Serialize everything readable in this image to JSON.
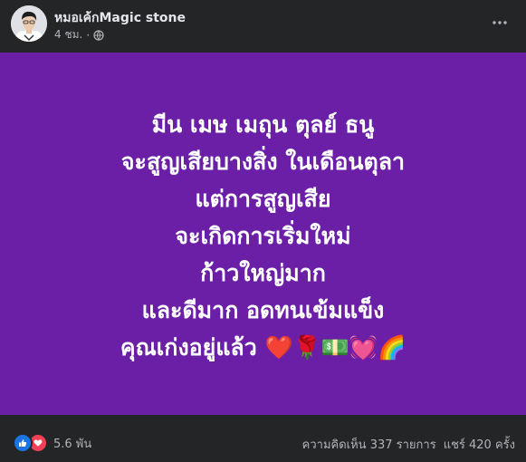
{
  "post": {
    "author": "หมอเค้กMagic stone",
    "time": "4 ชม.",
    "separator": "·",
    "background_color": "#6a1fa6",
    "lines": [
      "มีน เมษ เมถุน ตุลย์ ธนู",
      "จะสูญเสียบางสิ่ง ในเดือนตุลา",
      "แต่การสูญเสีย",
      "จะเกิดการเริ่มใหม่",
      "ก้าวใหญ่มาก",
      "และดีมาก อดทนเข้มแข็ง",
      "คุณเก่งอยู่แล้ว ❤️🌹💵💓🌈"
    ]
  },
  "reactions": {
    "count": "5.6 พัน",
    "icons": [
      "like-icon",
      "love-icon"
    ]
  },
  "stats": {
    "comments": "ความคิดเห็น 337 รายการ",
    "shares": "แชร์ 420 ครั้ง"
  },
  "colors": {
    "card_bg": "#242526",
    "text_primary": "#e4e6eb",
    "text_secondary": "#b0b3b8",
    "like_blue": "#1b74e4",
    "love_red": "#f33e58"
  }
}
